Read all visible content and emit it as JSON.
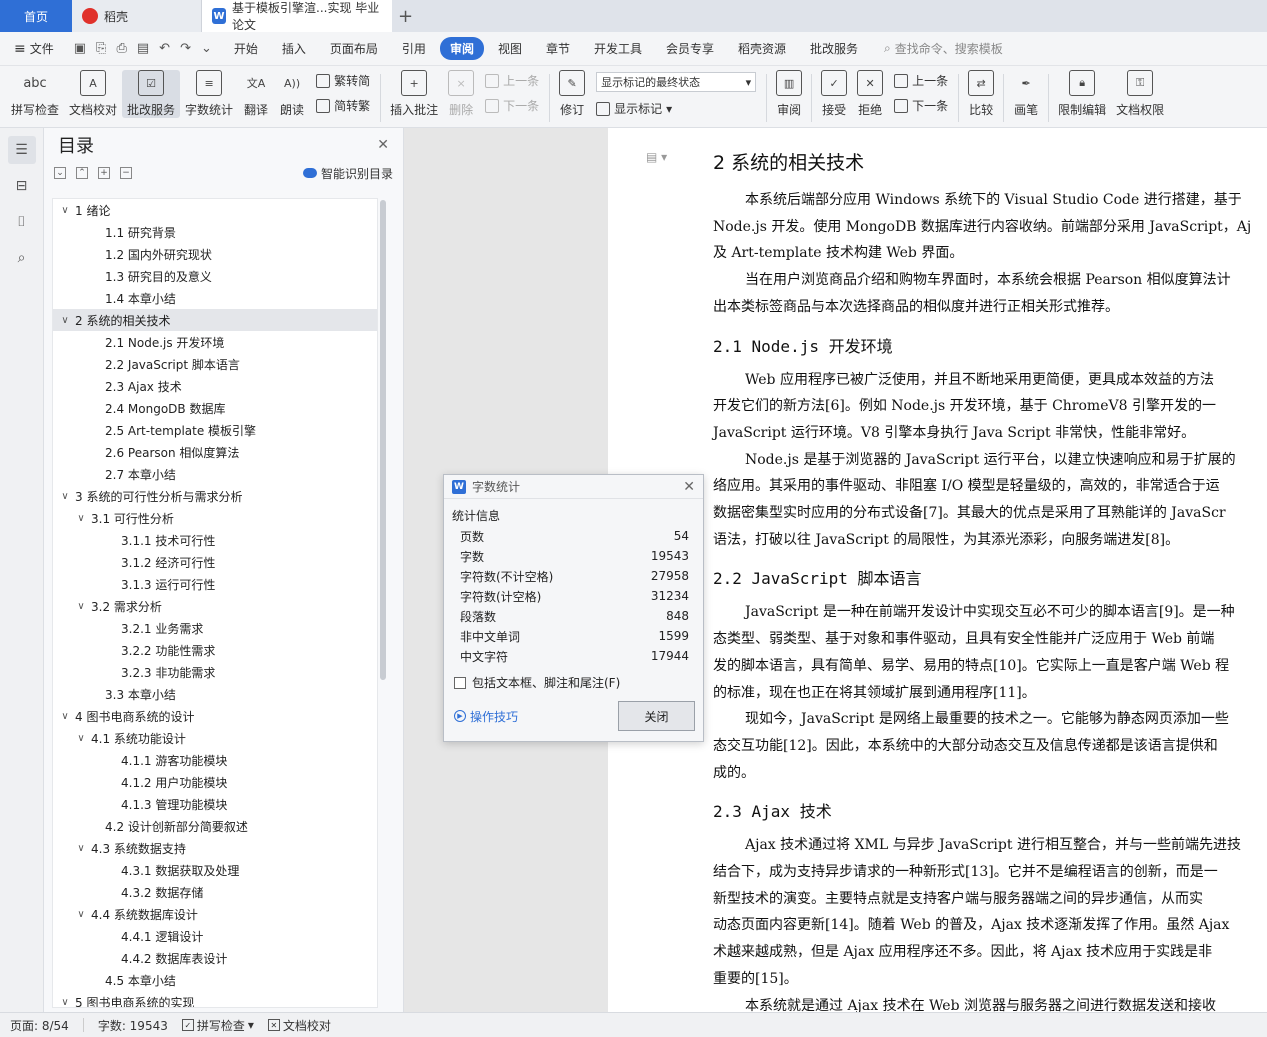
{
  "tabs": {
    "home": "首页",
    "daoke": "稻壳",
    "doc": "基于模板引擎渲...实现 毕业论文"
  },
  "menu": {
    "file": "文件",
    "items": [
      "开始",
      "插入",
      "页面布局",
      "引用",
      "审阅",
      "视图",
      "章节",
      "开发工具",
      "会员专享",
      "稻壳资源",
      "批改服务"
    ],
    "search": "查找命令、搜索模板"
  },
  "ribbon": {
    "spell": "拼写检查",
    "proof": "文档校对",
    "correct": "批改服务",
    "wordcount": "字数统计",
    "translate": "翻译",
    "read": "朗读",
    "trad": "繁转简",
    "simp": "简转繁",
    "insert_comment": "插入批注",
    "delete": "删除",
    "prev": "上一条",
    "next": "下一条",
    "revise": "修订",
    "show_markup_select": "显示标记的最终状态",
    "show_markup": "显示标记",
    "review": "审阅",
    "accept": "接受",
    "reject": "拒绝",
    "prev2": "上一条",
    "next2": "下一条",
    "compare": "比较",
    "pen": "画笔",
    "restrict": "限制编辑",
    "rights": "文档权限"
  },
  "outline": {
    "title": "目录",
    "smart": "智能识别目录",
    "items": [
      {
        "level": 0,
        "arrow": "∨",
        "text": "1  绪论"
      },
      {
        "level": 1,
        "arrow": "",
        "text": "1.1  研究背景"
      },
      {
        "level": 1,
        "arrow": "",
        "text": "1.2  国内外研究现状"
      },
      {
        "level": 1,
        "arrow": "",
        "text": "1.3  研究目的及意义"
      },
      {
        "level": 1,
        "arrow": "",
        "text": "1.4  本章小结"
      },
      {
        "level": 0,
        "arrow": "∨",
        "text": "2  系统的相关技术",
        "selected": true
      },
      {
        "level": 1,
        "arrow": "",
        "text": "2.1 Node.js 开发环境"
      },
      {
        "level": 1,
        "arrow": "",
        "text": "2.2 JavaScript 脚本语言"
      },
      {
        "level": 1,
        "arrow": "",
        "text": "2.3 Ajax 技术"
      },
      {
        "level": 1,
        "arrow": "",
        "text": "2.4 MongoDB 数据库"
      },
      {
        "level": 1,
        "arrow": "",
        "text": "2.5 Art-template 模板引擎"
      },
      {
        "level": 1,
        "arrow": "",
        "text": "2.6 Pearson 相似度算法"
      },
      {
        "level": 1,
        "arrow": "",
        "text": "2.7  本章小结"
      },
      {
        "level": 0,
        "arrow": "∨",
        "text": "3  系统的可行性分析与需求分析"
      },
      {
        "level": 1,
        "arrow": "∨",
        "text": "3.1  可行性分析"
      },
      {
        "level": 2,
        "arrow": "",
        "text": "3.1.1  技术可行性"
      },
      {
        "level": 2,
        "arrow": "",
        "text": "3.1.2  经济可行性"
      },
      {
        "level": 2,
        "arrow": "",
        "text": "3.1.3  运行可行性"
      },
      {
        "level": 1,
        "arrow": "∨",
        "text": "3.2  需求分析"
      },
      {
        "level": 2,
        "arrow": "",
        "text": "3.2.1  业务需求"
      },
      {
        "level": 2,
        "arrow": "",
        "text": "3.2.2  功能性需求"
      },
      {
        "level": 2,
        "arrow": "",
        "text": "3.2.3  非功能需求"
      },
      {
        "level": 1,
        "arrow": "",
        "text": "3.3  本章小结"
      },
      {
        "level": 0,
        "arrow": "∨",
        "text": "4  图书电商系统的设计"
      },
      {
        "level": 1,
        "arrow": "∨",
        "text": "4.1  系统功能设计"
      },
      {
        "level": 2,
        "arrow": "",
        "text": "4.1.1  游客功能模块"
      },
      {
        "level": 2,
        "arrow": "",
        "text": "4.1.2  用户功能模块"
      },
      {
        "level": 2,
        "arrow": "",
        "text": "4.1.3  管理功能模块"
      },
      {
        "level": 1,
        "arrow": "",
        "text": "4.2  设计创新部分简要叙述"
      },
      {
        "level": 1,
        "arrow": "∨",
        "text": "4.3  系统数据支持"
      },
      {
        "level": 2,
        "arrow": "",
        "text": "4.3.1  数据获取及处理"
      },
      {
        "level": 2,
        "arrow": "",
        "text": "4.3.2  数据存储"
      },
      {
        "level": 1,
        "arrow": "∨",
        "text": "4.4  系统数据库设计"
      },
      {
        "level": 2,
        "arrow": "",
        "text": "4.4.1  逻辑设计"
      },
      {
        "level": 2,
        "arrow": "",
        "text": "4.4.2  数据库表设计"
      },
      {
        "level": 1,
        "arrow": "",
        "text": "4.5  本章小结"
      },
      {
        "level": 0,
        "arrow": "∨",
        "text": "5  图书电商系统的实现"
      }
    ]
  },
  "document": {
    "blocks": [
      {
        "type": "h1",
        "text": "2 系统的相关技术"
      },
      {
        "type": "p",
        "ind": true,
        "text": "本系统后端部分应用 Windows 系统下的 Visual Studio Code 进行搭建，基于"
      },
      {
        "type": "p",
        "ind": false,
        "text": "Node.js 开发。使用 MongoDB 数据库进行内容收纳。前端部分采用 JavaScript，Aj"
      },
      {
        "type": "p",
        "ind": false,
        "text": "及 Art-template 技术构建 Web 界面。"
      },
      {
        "type": "p",
        "ind": true,
        "text": "当在用户浏览商品介绍和购物车界面时，本系统会根据 Pearson 相似度算法计"
      },
      {
        "type": "p",
        "ind": false,
        "text": "出本类标签商品与本次选择商品的相似度并进行正相关形式推荐。"
      },
      {
        "type": "h2",
        "text": "2.1 Node.js 开发环境"
      },
      {
        "type": "p",
        "ind": true,
        "text": "Web 应用程序已被广泛使用，并且不断地采用更简便，更具成本效益的方法"
      },
      {
        "type": "p",
        "ind": false,
        "text": "开发它们的新方法[6]。例如 Node.js 开发环境，基于 ChromeV8 引擎开发的一"
      },
      {
        "type": "p",
        "ind": false,
        "text": "JavaScript 运行环境。V8 引擎本身执行 Java Script 非常快，性能非常好。"
      },
      {
        "type": "p",
        "ind": true,
        "text": "Node.js 是基于浏览器的 JavaScript 运行平台，以建立快速响应和易于扩展的"
      },
      {
        "type": "p",
        "ind": false,
        "text": "络应用。其采用的事件驱动、非阻塞 I/O 模型是轻量级的，高效的，非常适合于运"
      },
      {
        "type": "p",
        "ind": false,
        "text": "数据密集型实时应用的分布式设备[7]。其最大的优点是采用了耳熟能详的 JavaScr"
      },
      {
        "type": "p",
        "ind": false,
        "text": "语法，打破以往 JavaScript 的局限性，为其添光添彩，向服务端进发[8]。"
      },
      {
        "type": "h2",
        "text": "2.2 JavaScript 脚本语言"
      },
      {
        "type": "p",
        "ind": true,
        "text": "JavaScript 是一种在前端开发设计中实现交互必不可少的脚本语言[9]。是一种"
      },
      {
        "type": "p",
        "ind": false,
        "text": "态类型、弱类型、基于对象和事件驱动，且具有安全性能并广泛应用于 Web 前端"
      },
      {
        "type": "p",
        "ind": false,
        "text": "发的脚本语言，具有简单、易学、易用的特点[10]。它实际上一直是客户端 Web 程"
      },
      {
        "type": "p",
        "ind": false,
        "text": "的标准，现在也正在将其领域扩展到通用程序[11]。"
      },
      {
        "type": "p",
        "ind": true,
        "text": "现如今，JavaScript 是网络上最重要的技术之一。它能够为静态网页添加一些"
      },
      {
        "type": "p",
        "ind": false,
        "text": "态交互功能[12]。因此，本系统中的大部分动态交互及信息传递都是该语言提供和"
      },
      {
        "type": "p",
        "ind": false,
        "text": "成的。"
      },
      {
        "type": "h2",
        "text": "2.3 Ajax 技术"
      },
      {
        "type": "p",
        "ind": true,
        "text": "Ajax 技术通过将 XML 与异步 JavaScript 进行相互整合，并与一些前端先进技"
      },
      {
        "type": "p",
        "ind": false,
        "text": "结合下，成为支持异步请求的一种新形式[13]。它并不是编程语言的创新，而是一"
      },
      {
        "type": "p",
        "ind": false,
        "text": "新型技术的演变。主要特点就是支持客户端与服务器端之间的异步通信，从而实"
      },
      {
        "type": "p",
        "ind": false,
        "text": "动态页面内容更新[14]。随着 Web 的普及，Ajax 技术逐渐发挥了作用。虽然 Ajax"
      },
      {
        "type": "p",
        "ind": false,
        "text": "术越来越成熟，但是 Ajax 应用程序还不多。因此，将 Ajax 技术应用于实践是非"
      },
      {
        "type": "p",
        "ind": false,
        "text": "重要的[15]。"
      },
      {
        "type": "p",
        "ind": true,
        "text": "本系统就是通过 Ajax 技术在 Web 浏览器与服务器之间进行数据发送和接收"
      }
    ]
  },
  "dialog": {
    "title": "字数统计",
    "section": "统计信息",
    "stats": [
      {
        "label": "页数",
        "value": "54"
      },
      {
        "label": "字数",
        "value": "19543"
      },
      {
        "label": "字符数(不计空格)",
        "value": "27958"
      },
      {
        "label": "字符数(计空格)",
        "value": "31234"
      },
      {
        "label": "段落数",
        "value": "848"
      },
      {
        "label": "非中文单词",
        "value": "1599"
      },
      {
        "label": "中文字符",
        "value": "17944"
      }
    ],
    "checkbox": "包括文本框、脚注和尾注(F)",
    "tips": "操作技巧",
    "close": "关闭"
  },
  "status": {
    "page": "页面: 8/54",
    "words": "字数: 19543",
    "spell": "拼写检查",
    "proof": "文档校对"
  },
  "colors": {
    "accent": "#2f6fd6",
    "wps_red": "#e0312b"
  }
}
